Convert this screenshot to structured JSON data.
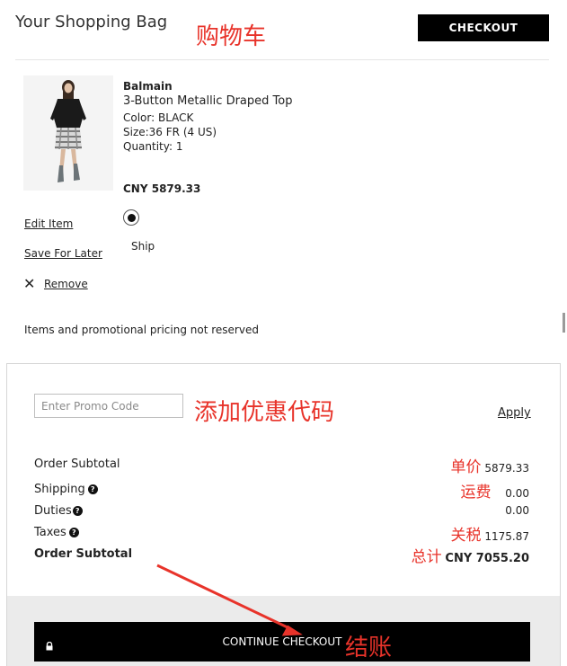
{
  "header": {
    "title": "Your Shopping Bag",
    "checkout_label": "CHECKOUT",
    "annotation": "购物车"
  },
  "product": {
    "brand": "Balmain",
    "name": "3-Button Metallic Draped Top",
    "color": "Color: BLACK",
    "size": "Size:36 FR (4 US)",
    "quantity": "Quantity: 1",
    "price": "CNY 5879.33",
    "actions": {
      "edit": "Edit Item",
      "save": "Save For Later",
      "remove": "Remove"
    },
    "delivery": {
      "option": "Ship",
      "selected": true
    }
  },
  "notice": "Items and promotional pricing not reserved",
  "promo": {
    "placeholder": "Enter Promo Code",
    "apply": "Apply",
    "annotation": "添加优惠代码"
  },
  "summary": {
    "rows": [
      {
        "label": "Order Subtotal",
        "value": "5879.33",
        "annotation": "单价"
      },
      {
        "label": "Shipping",
        "value": "0.00",
        "annotation": "运费"
      },
      {
        "label": "Duties",
        "value": "0.00",
        "annotation": ""
      },
      {
        "label": "Taxes",
        "value": "1175.87",
        "annotation": "关税"
      },
      {
        "label": "Order Subtotal",
        "value": "CNY 7055.20",
        "annotation": "总计"
      }
    ]
  },
  "checkout": {
    "label": "CONTINUE CHECKOUT",
    "annotation": "结账"
  },
  "icons": {
    "help": "question-circle-icon",
    "remove": "close-icon",
    "lock": "lock-icon",
    "annotation_arrow": "arrow-icon"
  },
  "colors": {
    "annotation": "#e8332a",
    "button": "#000000",
    "footer_bg": "#ebebeb"
  }
}
